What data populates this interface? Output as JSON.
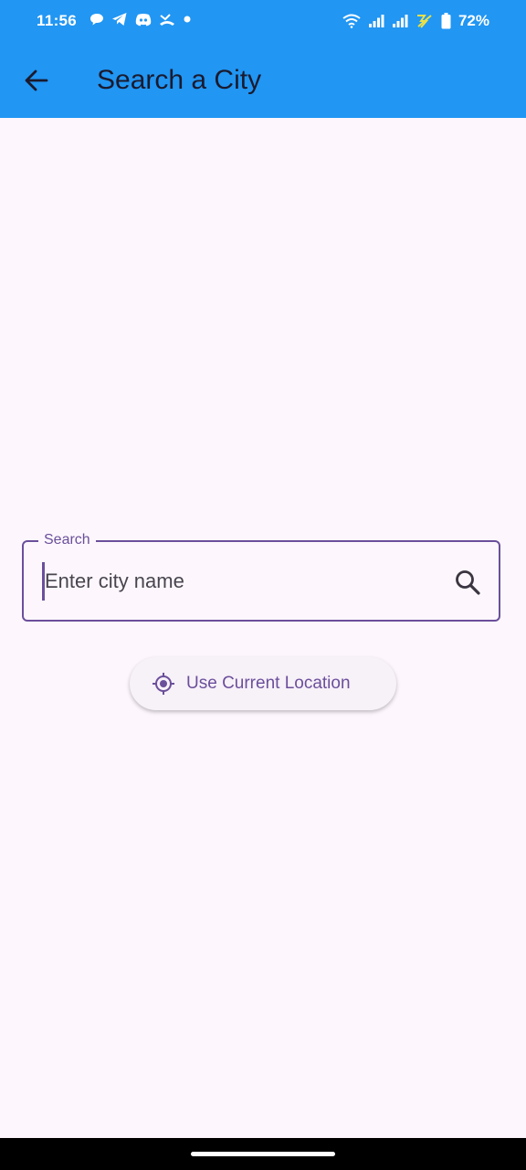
{
  "status_bar": {
    "time": "11:56",
    "battery": "72%",
    "notification_icons": [
      "chat-bubble-icon",
      "telegram-icon",
      "discord-icon",
      "missed-call-icon",
      "dot-icon"
    ],
    "system_icons": [
      "wifi-icon",
      "signal-icon",
      "signal-icon",
      "no-charge-icon",
      "battery-icon"
    ]
  },
  "app_bar": {
    "title": "Search a City",
    "back_icon": "arrow-left-icon",
    "color": "#2196f3"
  },
  "search": {
    "label": "Search",
    "placeholder": "Enter city name",
    "value": "",
    "icon": "search-icon",
    "accent": "#6b4f9b"
  },
  "location_button": {
    "label": "Use Current Location",
    "icon": "crosshair-location-icon"
  }
}
